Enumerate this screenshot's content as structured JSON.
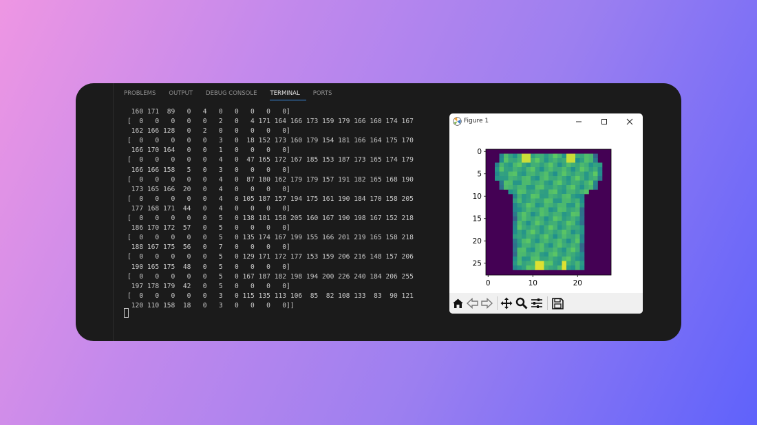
{
  "panel": {
    "tabs": [
      {
        "label": "PROBLEMS",
        "active": false
      },
      {
        "label": "OUTPUT",
        "active": false
      },
      {
        "label": "DEBUG CONSOLE",
        "active": false
      },
      {
        "label": "TERMINAL",
        "active": true
      },
      {
        "label": "PORTS",
        "active": false
      }
    ],
    "accent_color": "#3c8fe6"
  },
  "terminal": {
    "lines": [
      " 160 171  89   0   4   0   0   0   0   0]",
      "[  0   0   0   0   0   2   0   4 171 164 166 173 159 179 166 160 174 167",
      " 162 166 128   0   2   0   0   0   0   0]",
      "[  0   0   0   0   0   3   0  18 152 173 160 179 154 181 166 164 175 170",
      " 166 170 164   0   0   1   0   0   0   0]",
      "[  0   0   0   0   0   4   0  47 165 172 167 185 153 187 173 165 174 179",
      " 166 166 158   5   0   3   0   0   0   0]",
      "[  0   0   0   0   0   4   0  87 180 162 179 179 157 191 182 165 168 190",
      " 173 165 166  20   0   4   0   0   0   0]",
      "[  0   0   0   0   0   4   0 105 187 157 194 175 161 190 184 170 158 205",
      " 177 168 171  44   0   4   0   0   0   0]",
      "[  0   0   0   0   0   5   0 138 181 158 205 160 167 190 198 167 152 218",
      " 186 170 172  57   0   5   0   0   0   0]",
      "[  0   0   0   0   0   5   0 135 174 167 199 155 166 201 219 165 158 218",
      " 188 167 175  56   0   7   0   0   0   0]",
      "[  0   0   0   0   0   5   0 129 171 172 177 153 159 206 216 148 157 206",
      " 190 165 175  48   0   5   0   0   0   0]",
      "[  0   0   0   0   0   5   0 167 187 182 198 194 200 226 240 184 206 255",
      " 197 178 179  42   0   5   0   0   0   0]",
      "[  0   0   0   0   0   3   0 115 135 113 106  85  82 108 133  83  90 121",
      " 120 110 158  18   0   3   0   0   0   0]]"
    ]
  },
  "figure": {
    "title": "Figure 1",
    "window_buttons": [
      "minimize-icon",
      "maximize-icon",
      "close-icon"
    ],
    "toolbar_icons": [
      "home-icon",
      "back-icon",
      "forward-icon",
      "pan-icon",
      "zoom-icon",
      "configure-icon",
      "save-icon"
    ]
  },
  "chart_data": {
    "type": "heatmap",
    "title": "",
    "xlabel": "",
    "ylabel": "",
    "x_ticks": [
      "0",
      "10",
      "20"
    ],
    "y_ticks": [
      "0",
      "5",
      "10",
      "15",
      "20",
      "25"
    ],
    "xlim": [
      -0.5,
      27.5
    ],
    "ylim": [
      27.5,
      -0.5
    ],
    "colormap": "viridis",
    "background_color": "#440154",
    "shirt_color": "#2fb47c",
    "description_shape": "t-shirt image, 28x28 pixel grid"
  }
}
